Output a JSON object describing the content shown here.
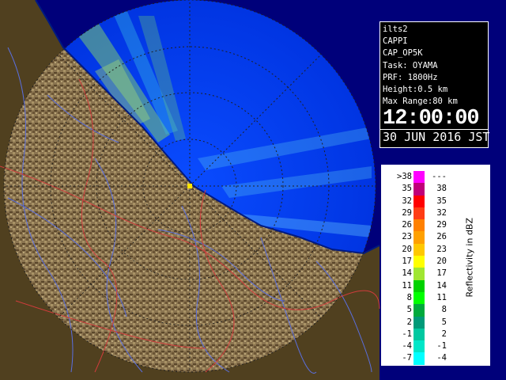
{
  "info": {
    "lines": [
      "ilts2",
      "CAPPI",
      "CAP_OP5K",
      "Task: OYAMA",
      "PRF: 1800Hz",
      "Height:0.5 km",
      "Max Range:80 km"
    ],
    "time": "12:00:00",
    "date": "30 JUN 2016 JST"
  },
  "legend": {
    "unit_label": "Reflectivity in dBZ",
    "rows": [
      {
        "lo": ">38",
        "hi": "---",
        "color": "#ff00ff"
      },
      {
        "lo": "35",
        "hi": "38",
        "color": "#c0007a"
      },
      {
        "lo": "32",
        "hi": "35",
        "color": "#ff0000"
      },
      {
        "lo": "29",
        "hi": "32",
        "color": "#ff3c14"
      },
      {
        "lo": "26",
        "hi": "29",
        "color": "#ff8000"
      },
      {
        "lo": "23",
        "hi": "26",
        "color": "#ffa000"
      },
      {
        "lo": "20",
        "hi": "23",
        "color": "#ffc800"
      },
      {
        "lo": "17",
        "hi": "20",
        "color": "#ffff00"
      },
      {
        "lo": "14",
        "hi": "17",
        "color": "#a0e632"
      },
      {
        "lo": "11",
        "hi": "14",
        "color": "#00d200"
      },
      {
        "lo": "8",
        "hi": "11",
        "color": "#00ff00"
      },
      {
        "lo": "5",
        "hi": "8",
        "color": "#00aa3c"
      },
      {
        "lo": "2",
        "hi": "5",
        "color": "#009a78"
      },
      {
        "lo": "-1",
        "hi": "2",
        "color": "#00c8a0"
      },
      {
        "lo": "-4",
        "hi": "-1",
        "color": "#00e6c8"
      },
      {
        "lo": "-7",
        "hi": "-4",
        "color": "#00ffff"
      }
    ]
  },
  "map_colors": {
    "sea": "#0044ff",
    "land_light": "#a89262",
    "land_dark": "#4a3a22",
    "river": "#5a6fe0",
    "boundary": "#d03c3c",
    "echo_green": "#9ef05a",
    "echo_cyan": "#40e8f0"
  }
}
